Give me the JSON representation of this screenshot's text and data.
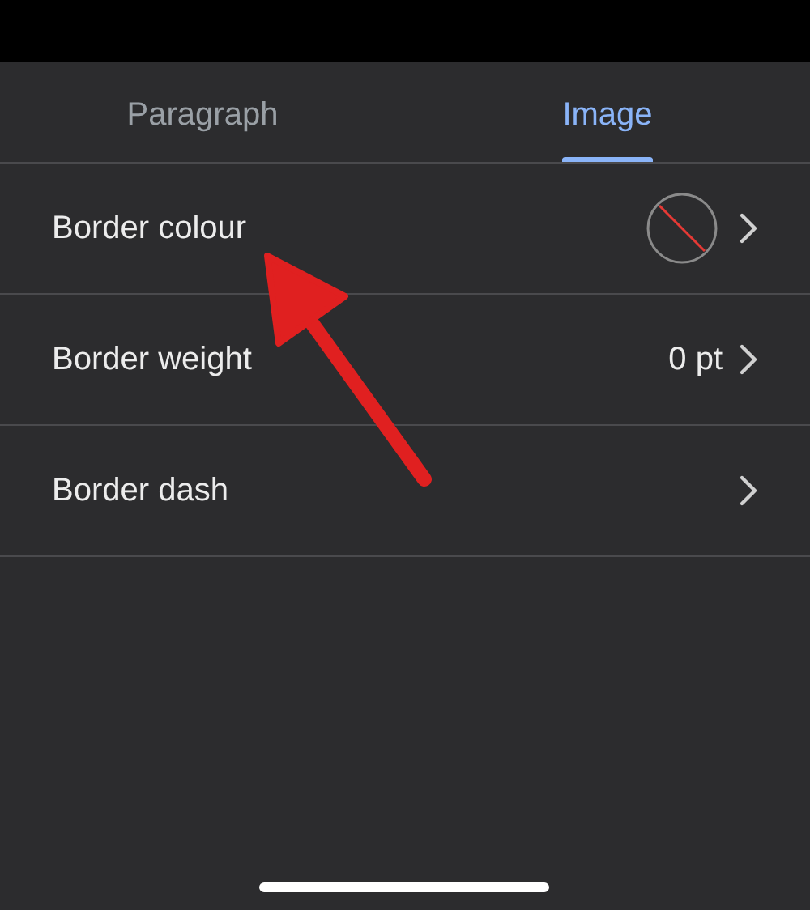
{
  "tabs": [
    {
      "label": "Paragraph",
      "selected": false
    },
    {
      "label": "Image",
      "selected": true
    }
  ],
  "rows": [
    {
      "label": "Border colour",
      "kind": "color"
    },
    {
      "label": "Border weight",
      "kind": "value",
      "value": "0 pt"
    },
    {
      "label": "Border dash",
      "kind": "plain"
    }
  ]
}
